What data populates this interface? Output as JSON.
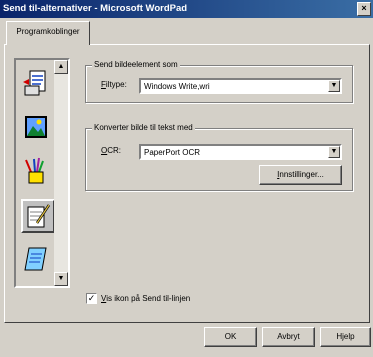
{
  "window": {
    "title": "Send til-alternativer - Microsoft WordPad",
    "close_glyph": "×"
  },
  "tabs": [
    {
      "label": "Programkoblinger"
    }
  ],
  "icon_list": {
    "items": [
      {
        "name": "document-send-icon"
      },
      {
        "name": "picture-icon"
      },
      {
        "name": "pencils-cup-icon"
      },
      {
        "name": "notepad-pen-icon",
        "selected": true
      },
      {
        "name": "book-icon"
      }
    ],
    "scroll_up_glyph": "▲",
    "scroll_down_glyph": "▼"
  },
  "send_group": {
    "title": "Send bildeelement som",
    "filetype_label_underline": "F",
    "filetype_label_rest": "iltype:",
    "filetype_value": "Windows Write,wri"
  },
  "ocr_group": {
    "title": "Konverter bilde til tekst med",
    "ocr_label_underline": "O",
    "ocr_label_rest": "CR:",
    "ocr_value": "PaperPort OCR",
    "settings_button_underline": "I",
    "settings_button_rest": "nnstillinger..."
  },
  "show_icon_checkbox": {
    "checked": true,
    "check_glyph": "✓",
    "label_underline": "V",
    "label_rest": "is ikon på Send til-linjen"
  },
  "buttons": {
    "ok": "OK",
    "cancel": "Avbryt",
    "help": "Hjelp"
  },
  "combo_arrow_glyph": "▼"
}
